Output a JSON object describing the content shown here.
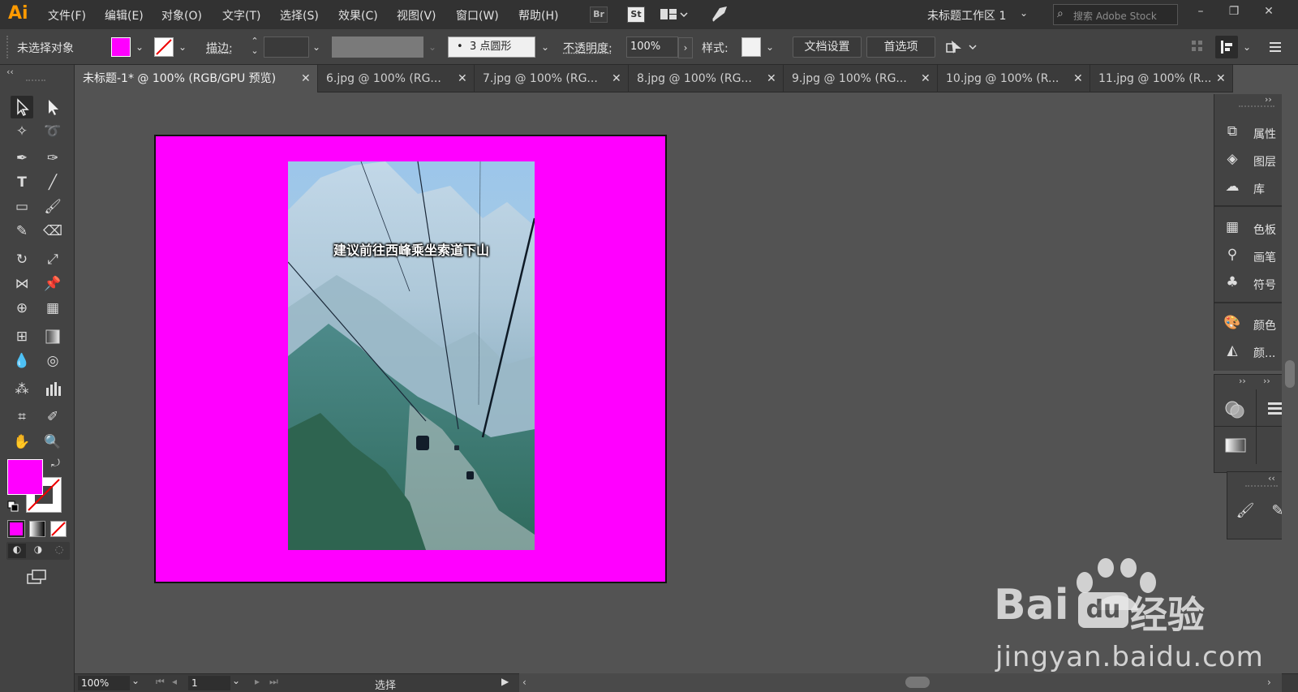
{
  "app": {
    "logo": "Ai",
    "menu": [
      "文件(F)",
      "编辑(E)",
      "对象(O)",
      "文字(T)",
      "选择(S)",
      "效果(C)",
      "视图(V)",
      "窗口(W)",
      "帮助(H)"
    ],
    "bridge_icon": "Br",
    "stock_icon": "St",
    "workspace": "未标题工作区 1",
    "search_placeholder": "搜索 Adobe Stock",
    "window_controls": [
      "–",
      "❐",
      "✕"
    ]
  },
  "control_bar": {
    "selection_status": "未选择对象",
    "fill_color": "#ff00ff",
    "stroke_label": "描边:",
    "brush_label": "3 点圆形",
    "opacity_label": "不透明度:",
    "opacity_value": "100%",
    "style_label": "样式:",
    "doc_setup_button": "文档设置",
    "preferences_button": "首选项"
  },
  "tabs": [
    {
      "label": "未标题-1* @ 100% (RGB/GPU 预览)",
      "active": true
    },
    {
      "label": "6.jpg @ 100% (RG...",
      "active": false
    },
    {
      "label": "7.jpg @ 100% (RG...",
      "active": false
    },
    {
      "label": "8.jpg @ 100% (RG...",
      "active": false
    },
    {
      "label": "9.jpg @ 100% (RG...",
      "active": false
    },
    {
      "label": "10.jpg @ 100% (R...",
      "active": false
    },
    {
      "label": "11.jpg @ 100% (R...",
      "active": false
    }
  ],
  "canvas": {
    "artboard_color": "#ff00ff",
    "photo_caption": "建议前往西峰乘坐索道下山"
  },
  "panels": {
    "main": [
      {
        "label": "属性",
        "icon": "properties-icon"
      },
      {
        "label": "图层",
        "icon": "layers-icon"
      },
      {
        "label": "库",
        "icon": "libraries-icon"
      },
      {
        "label": "色板",
        "icon": "swatches-icon"
      },
      {
        "label": "画笔",
        "icon": "brushes-icon"
      },
      {
        "label": "符号",
        "icon": "symbols-icon"
      },
      {
        "label": "颜色",
        "icon": "color-icon"
      },
      {
        "label": "颜...",
        "icon": "color-guide-icon"
      }
    ]
  },
  "status_bar": {
    "zoom": "100%",
    "artboard_number": "1",
    "tool_status": "选择"
  },
  "watermark": {
    "brand": "Bai",
    "brand_suffix": "经验",
    "url": "jingyan.baidu.com"
  }
}
